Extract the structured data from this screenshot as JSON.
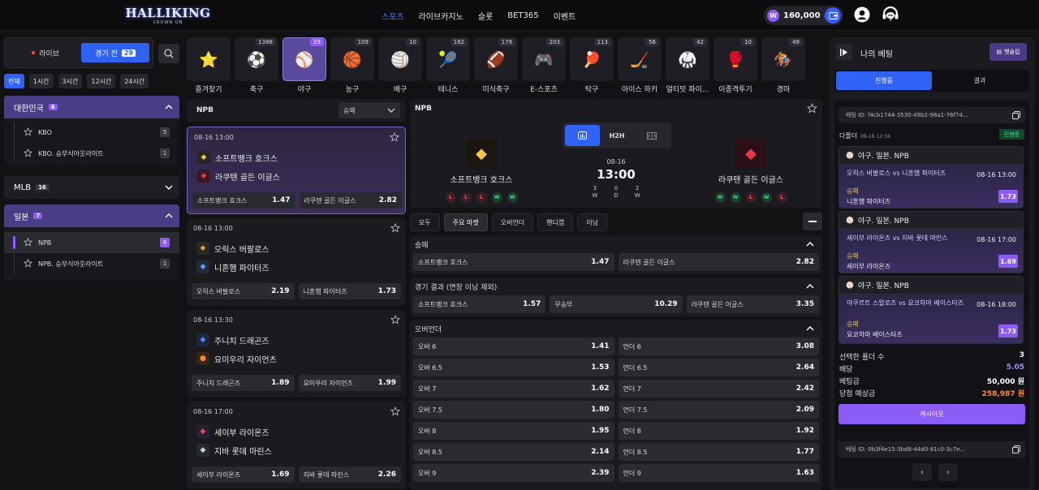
{
  "brand": {
    "logo_text": "HALLIKING",
    "logo_sub": "CROWN ON"
  },
  "nav": [
    "스포츠",
    "라이브카지노",
    "슬롯",
    "BET365",
    "이벤트"
  ],
  "balance": {
    "coin": "W",
    "value": "160,000"
  },
  "left": {
    "live_label": "라이브",
    "prematch_label": "경기 전",
    "prematch_count": "29",
    "time_filters": [
      "전체",
      "1시간",
      "3시간",
      "12시간",
      "24시간"
    ],
    "leagues": [
      {
        "name": "대한민국",
        "count": "6",
        "subs": [
          {
            "name": "KBO",
            "count": "5"
          },
          {
            "name": "KBO. 승부식아웃라이트",
            "count": "1"
          }
        ]
      },
      {
        "name": "MLB",
        "count": "16"
      },
      {
        "name": "일본",
        "count": "7",
        "subs": [
          {
            "name": "NPB",
            "count": "6"
          },
          {
            "name": "NPB. 승부식아웃라이트",
            "count": "1"
          }
        ]
      }
    ]
  },
  "sports": [
    {
      "label": "즐겨찾기",
      "count": "",
      "icon": "⭐"
    },
    {
      "label": "축구",
      "count": "1388",
      "icon": "⚽"
    },
    {
      "label": "야구",
      "count": "29",
      "icon": "⚾"
    },
    {
      "label": "농구",
      "count": "109",
      "icon": "🏀"
    },
    {
      "label": "배구",
      "count": "10",
      "icon": "🏐"
    },
    {
      "label": "테니스",
      "count": "182",
      "icon": "🎾"
    },
    {
      "label": "미식축구",
      "count": "179",
      "icon": "🏈"
    },
    {
      "label": "E-스포츠",
      "count": "203",
      "icon": "🎮"
    },
    {
      "label": "탁구",
      "count": "113",
      "icon": "🏓"
    },
    {
      "label": "아이스 하키",
      "count": "56",
      "icon": "🏒"
    },
    {
      "label": "얼티밋 파이...",
      "count": "42",
      "icon": "🥋"
    },
    {
      "label": "이종격투기",
      "count": "10",
      "icon": "🥊"
    },
    {
      "label": "경마",
      "count": "49",
      "icon": "🏇"
    }
  ],
  "matchlist": {
    "league": "NPB",
    "market_select": "승패",
    "matches": [
      {
        "time": "08-16 13:00",
        "home": "소프트뱅크 호크스",
        "away": "라쿠텐 골든 이글스",
        "home_short": "소프트뱅크 호크스",
        "away_short": "라쿠텐 골든 이글스",
        "home_odd": "1.47",
        "away_odd": "2.82"
      },
      {
        "time": "08-16 13:00",
        "home": "오릭스 버팔로스",
        "away": "니혼햄 파이터즈",
        "home_short": "오릭스 버팔로스",
        "away_short": "니혼햄 파이터즈",
        "home_odd": "2.19",
        "away_odd": "1.73"
      },
      {
        "time": "08-16 13:30",
        "home": "주니치 드래곤즈",
        "away": "요미우리 자이언츠",
        "home_short": "주니치 드래곤즈",
        "away_short": "요미우리 자이언츠",
        "home_odd": "1.89",
        "away_odd": "1.99"
      },
      {
        "time": "08-16 17:00",
        "home": "세이부 라이온즈",
        "away": "지바 롯데 마린스",
        "home_short": "세이부 라이온즈",
        "away_short": "지바 롯데 마린스",
        "home_odd": "1.69",
        "away_odd": "2.26"
      }
    ]
  },
  "detail": {
    "league": "NPB",
    "tab_h2h": "H2H",
    "home": "소프트뱅크 호크스",
    "away": "라쿠텐 골든 이글스",
    "home_form": [
      "L",
      "L",
      "L",
      "W",
      "W"
    ],
    "away_form": [
      "W",
      "W",
      "L",
      "W",
      "L"
    ],
    "date": "08-16",
    "time": "13:00",
    "wdl": [
      {
        "n": "3",
        "l": "W"
      },
      {
        "n": "0",
        "l": "D"
      },
      {
        "n": "2",
        "l": "W"
      }
    ],
    "market_tabs": [
      "모두",
      "주요 마켓",
      "오버언더",
      "핸디캡",
      "이닝"
    ],
    "sections": [
      {
        "title": "승패",
        "rows": [
          [
            {
              "l": "소프트뱅크 호크스",
              "v": "1.47"
            },
            {
              "l": "라쿠텐 골든 이글스",
              "v": "2.82"
            }
          ]
        ]
      },
      {
        "title": "경기 결과 (연장 이닝 제외)",
        "rows": [
          [
            {
              "l": "소프트뱅크 호크스",
              "v": "1.57"
            },
            {
              "l": "무승부",
              "v": "10.29"
            },
            {
              "l": "라쿠텐 골든 이글스",
              "v": "3.35"
            }
          ]
        ]
      },
      {
        "title": "오버언더",
        "rows": [
          [
            {
              "l": "오버 6",
              "v": "1.41"
            },
            {
              "l": "언더 6",
              "v": "3.08"
            }
          ],
          [
            {
              "l": "오버 6.5",
              "v": "1.53"
            },
            {
              "l": "언더 6.5",
              "v": "2.64"
            }
          ],
          [
            {
              "l": "오버 7",
              "v": "1.62"
            },
            {
              "l": "언더 7",
              "v": "2.42"
            }
          ],
          [
            {
              "l": "오버 7.5",
              "v": "1.80"
            },
            {
              "l": "언더 7.5",
              "v": "2.09"
            }
          ],
          [
            {
              "l": "오버 8",
              "v": "1.95"
            },
            {
              "l": "언더 8",
              "v": "1.92"
            }
          ],
          [
            {
              "l": "오버 8.5",
              "v": "2.14"
            },
            {
              "l": "언더 8.5",
              "v": "1.77"
            }
          ],
          [
            {
              "l": "오버 9",
              "v": "2.39"
            },
            {
              "l": "언더 9",
              "v": "1.63"
            }
          ]
        ]
      }
    ]
  },
  "betslip": {
    "title": "나의 베팅",
    "button": "벳슬립",
    "tab_active": "진행중",
    "tab_result": "결과",
    "bet_id_1": "베팅 ID: f4cb1744-3530-49b2-98a1-76f74...",
    "multi_label": "다폴더",
    "multi_time": "08-16 12:34",
    "status": "진행중",
    "bets": [
      {
        "head": "야구. 일본. NPB",
        "match": "오릭스 버팔로스 vs 니혼햄 파이터즈",
        "time": "08-16 13:00",
        "pick_type": "승패",
        "pick": "니혼햄 파이터즈",
        "odd": "1.73"
      },
      {
        "head": "야구. 일본. NPB",
        "match": "세이부 라이온즈 vs 지바 롯데 마린스",
        "time": "08-16 17:00",
        "pick_type": "승패",
        "pick": "세이부 라이온즈",
        "odd": "1.69"
      },
      {
        "head": "야구. 일본. NPB",
        "match": "야쿠르트 스왈로즈 vs 요코하마 베이스타즈",
        "time": "08-16 18:00",
        "pick_type": "승패",
        "pick": "요코하마 베이스타즈",
        "odd": "1.73"
      }
    ],
    "summary": [
      {
        "k": "선택한 폴더 수",
        "v": "3"
      },
      {
        "k": "배당",
        "v": "5.05"
      },
      {
        "k": "베팅금",
        "v": "50,000 원"
      },
      {
        "k": "당첨 예상금",
        "v": "258,987 원"
      }
    ],
    "cashout": "캐시아웃",
    "bet_id_2": "베팅 ID: 0b3f4e15-3bd8-44d0-81c0-3c7e...",
    "pager_prev": "‹",
    "pager_next": "›"
  }
}
